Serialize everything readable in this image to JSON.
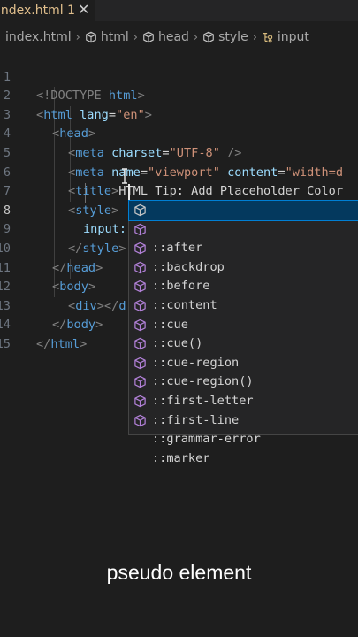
{
  "tab": {
    "label": "index.html 1",
    "close_glyph": "✕"
  },
  "breadcrumb": [
    {
      "label": "index.html",
      "icon": ""
    },
    {
      "label": "html",
      "icon": "cube-icon"
    },
    {
      "label": "head",
      "icon": "cube-icon"
    },
    {
      "label": "style",
      "icon": "cube-icon"
    },
    {
      "label": "input",
      "icon": "selector-icon"
    }
  ],
  "line_numbers": [
    "1",
    "2",
    "3",
    "4",
    "5",
    "6",
    "7",
    "8",
    "9",
    "10",
    "11",
    "12",
    "13",
    "14",
    "15"
  ],
  "active_line": "8",
  "code": {
    "l1_a": "<!DOCTYPE",
    "l1_b": " html",
    "l1_c": ">",
    "l2_a": "<",
    "l2_b": "html",
    "l2_c": " lang",
    "l2_d": "=",
    "l2_e": "\"en\"",
    "l2_f": ">",
    "l3_a": "<",
    "l3_b": "head",
    "l3_c": ">",
    "l4_a": "<",
    "l4_b": "meta",
    "l4_c": " charset",
    "l4_d": "=",
    "l4_e": "\"UTF-8\"",
    "l4_f": " />",
    "l5_a": "<",
    "l5_b": "meta",
    "l5_c": " name",
    "l5_d": "=",
    "l5_e": "\"viewport\"",
    "l5_f": " content",
    "l5_g": "=",
    "l5_h": "\"width=d",
    "l6_a": "<",
    "l6_b": "title",
    "l6_c": ">",
    "l6_d": "HTML Tip: Add Placeholder Color",
    "l7_a": "<",
    "l7_b": "style",
    "l7_c": ">",
    "l8_a": "input:",
    "l9_a": "</",
    "l9_b": "style",
    "l9_c": ">",
    "l10_a": "</",
    "l10_b": "head",
    "l10_c": ">",
    "l11_a": "<",
    "l11_b": "body",
    "l11_c": ">",
    "l12_a": "<",
    "l12_b": "div",
    "l12_c": "></",
    "l12_d": "d",
    "l13_a": "</",
    "l13_b": "body",
    "l13_c": ">",
    "l14_a": "</",
    "l14_b": "html",
    "l14_c": ">"
  },
  "suggestions": [
    "::after",
    "::backdrop",
    "::before",
    "::content",
    "::cue",
    "::cue()",
    "::cue-region",
    "::cue-region()",
    "::first-letter",
    "::first-line",
    "::grammar-error",
    "::marker"
  ],
  "suggestion_icon": "cube-icon",
  "caption": "pseudo element",
  "colors": {
    "tag": "#569cd6",
    "attr": "#9cdcfe",
    "string": "#ce9178",
    "punct": "#808080",
    "selection": "#04395e",
    "icon": "#b180d7"
  }
}
